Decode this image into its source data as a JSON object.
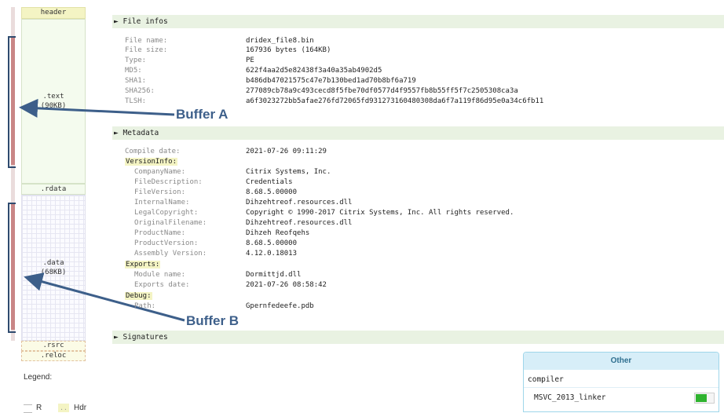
{
  "section_map": {
    "header": "header",
    "text": ".text",
    "text_size": "(90KB)",
    "rdata": ".rdata",
    "data": ".data",
    "data_size": "(68KB)",
    "rsrc": ".rsrc",
    "reloc": ".reloc"
  },
  "legend": {
    "title": "Legend:",
    "r_label": "R",
    "hdr_label": "Hdr"
  },
  "annotations": {
    "buffer_a": "Buffer A",
    "buffer_b": "Buffer B"
  },
  "file_infos": {
    "heading": "File infos",
    "rows": [
      {
        "key": "File name:",
        "value": "dridex_file8.bin"
      },
      {
        "key": "File size:",
        "value": "167936 bytes (164KB)"
      },
      {
        "key": "Type:",
        "value": "PE"
      },
      {
        "key": "MD5:",
        "value": "622f4aa2d5e82438f3a40a35ab4902d5"
      },
      {
        "key": "SHA1:",
        "value": "b486db47021575c47e7b130bed1ad70b8bf6a719"
      },
      {
        "key": "SHA256:",
        "value": "277089cb78a9c493cecd8f5fbe70df0577d4f9557fb8b55ff5f7c2505308ca3a"
      },
      {
        "key": "TLSH:",
        "value": "a6f3023272bb5afae276fd72065fd931273160480308da6f7a119f86d95e0a34c6fb11"
      }
    ]
  },
  "metadata": {
    "heading": "Metadata",
    "compile_key": "Compile date:",
    "compile_value": "2021-07-26 09:11:29",
    "versioninfo_label": "VersionInfo:",
    "versioninfo": [
      {
        "key": "CompanyName:",
        "value": "Citrix Systems, Inc."
      },
      {
        "key": "FileDescription:",
        "value": "Credentials"
      },
      {
        "key": "FileVersion:",
        "value": "8.68.5.00000"
      },
      {
        "key": "InternalName:",
        "value": "Dihzehtreof.resources.dll"
      },
      {
        "key": "LegalCopyright:",
        "value": "Copyright © 1990-2017 Citrix Systems, Inc. All rights reserved."
      },
      {
        "key": "OriginalFilename:",
        "value": "Dihzehtreof.resources.dll"
      },
      {
        "key": "ProductName:",
        "value": "Dihzeh Reofqehs"
      },
      {
        "key": "ProductVersion:",
        "value": "8.68.5.00000"
      },
      {
        "key": "Assembly Version:",
        "value": "4.12.0.18013"
      }
    ],
    "exports_label": "Exports:",
    "exports": [
      {
        "key": "Module name:",
        "value": "Dormittjd.dll"
      },
      {
        "key": "Exports date:",
        "value": "2021-07-26 08:58:42"
      }
    ],
    "debug_label": "Debug:",
    "debug": [
      {
        "key": "Path:",
        "value": "Gpernfedeefe.pdb"
      }
    ]
  },
  "signatures": {
    "heading": "Signatures"
  },
  "other": {
    "title": "Other",
    "subheading": "compiler",
    "item": "MSVC_2013_linker"
  },
  "colors": {
    "section_header_bg": "#e9f2e2",
    "other_header_bg": "#d7eef8",
    "callout": "#3d5f8a",
    "toggle_on": "#2fb32f"
  }
}
